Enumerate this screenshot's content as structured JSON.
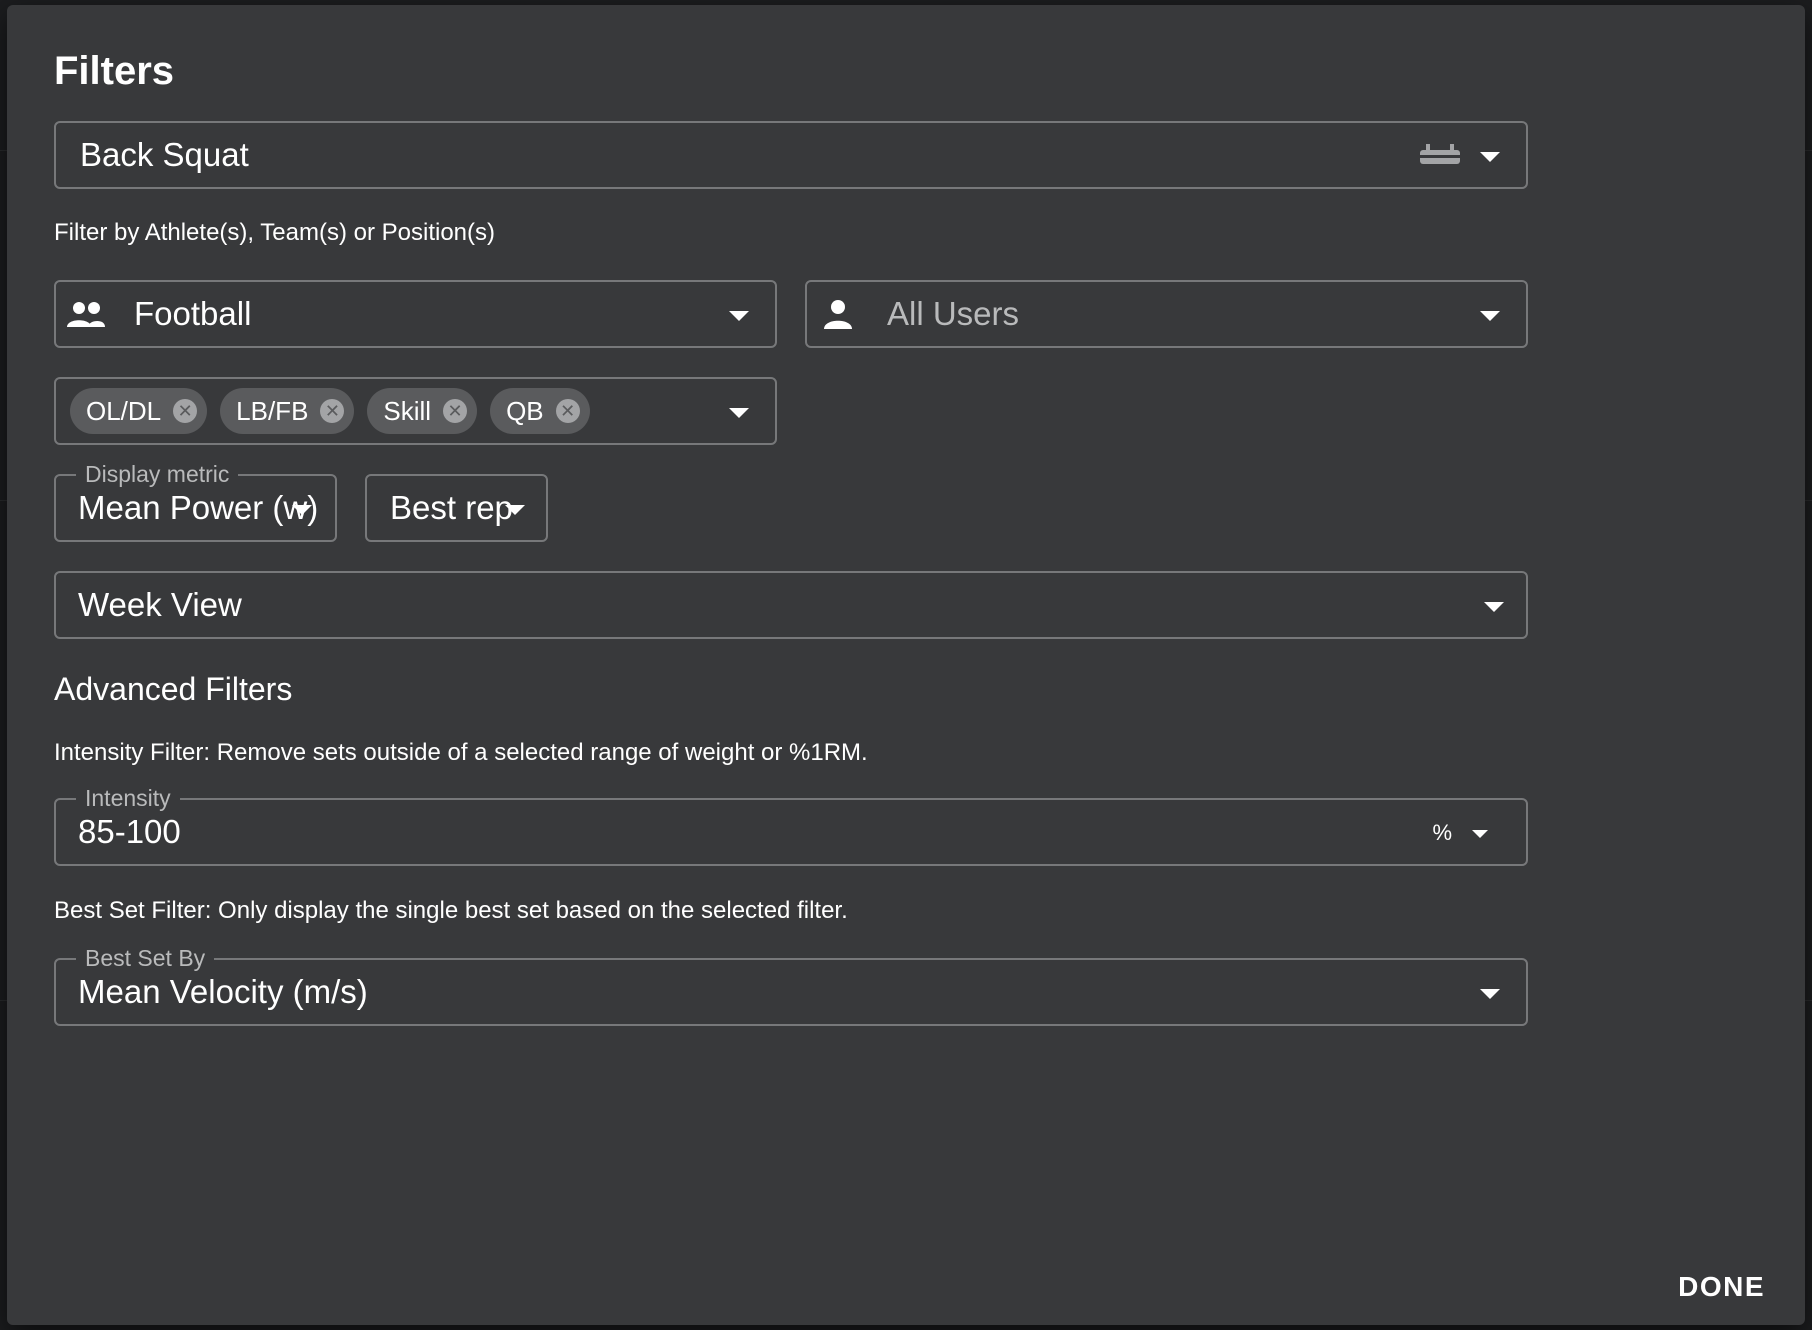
{
  "dialog": {
    "title": "Filters",
    "done_label": "DONE"
  },
  "exercise": {
    "value": "Back Squat",
    "icon": "barbell-icon"
  },
  "athlete_filter": {
    "helper": "Filter by Athlete(s), Team(s) or Position(s)",
    "team": {
      "value": "Football",
      "icon": "group-icon"
    },
    "users": {
      "value": "All Users",
      "icon": "person-icon"
    },
    "positions": [
      {
        "label": "OL/DL"
      },
      {
        "label": "LB/FB"
      },
      {
        "label": "Skill"
      },
      {
        "label": "QB"
      }
    ]
  },
  "display_metric": {
    "legend": "Display metric",
    "value": "Mean Power (w)",
    "rep_value": "Best rep"
  },
  "view": {
    "value": "Week View"
  },
  "advanced": {
    "heading": "Advanced Filters",
    "intensity_helper": "Intensity Filter: Remove sets outside of a selected range of weight or %1RM.",
    "intensity": {
      "legend": "Intensity",
      "value": "85-100",
      "unit": "%"
    },
    "best_set_helper": "Best Set Filter: Only display the single best set based on the selected filter.",
    "best_set": {
      "legend": "Best Set By",
      "value": "Mean Velocity (m/s)"
    }
  },
  "colors": {
    "dialog_bg": "#38393b",
    "border": "#77787a",
    "chip_bg": "#5a5b5d",
    "text": "#ffffff",
    "muted_text": "#b9babb"
  }
}
